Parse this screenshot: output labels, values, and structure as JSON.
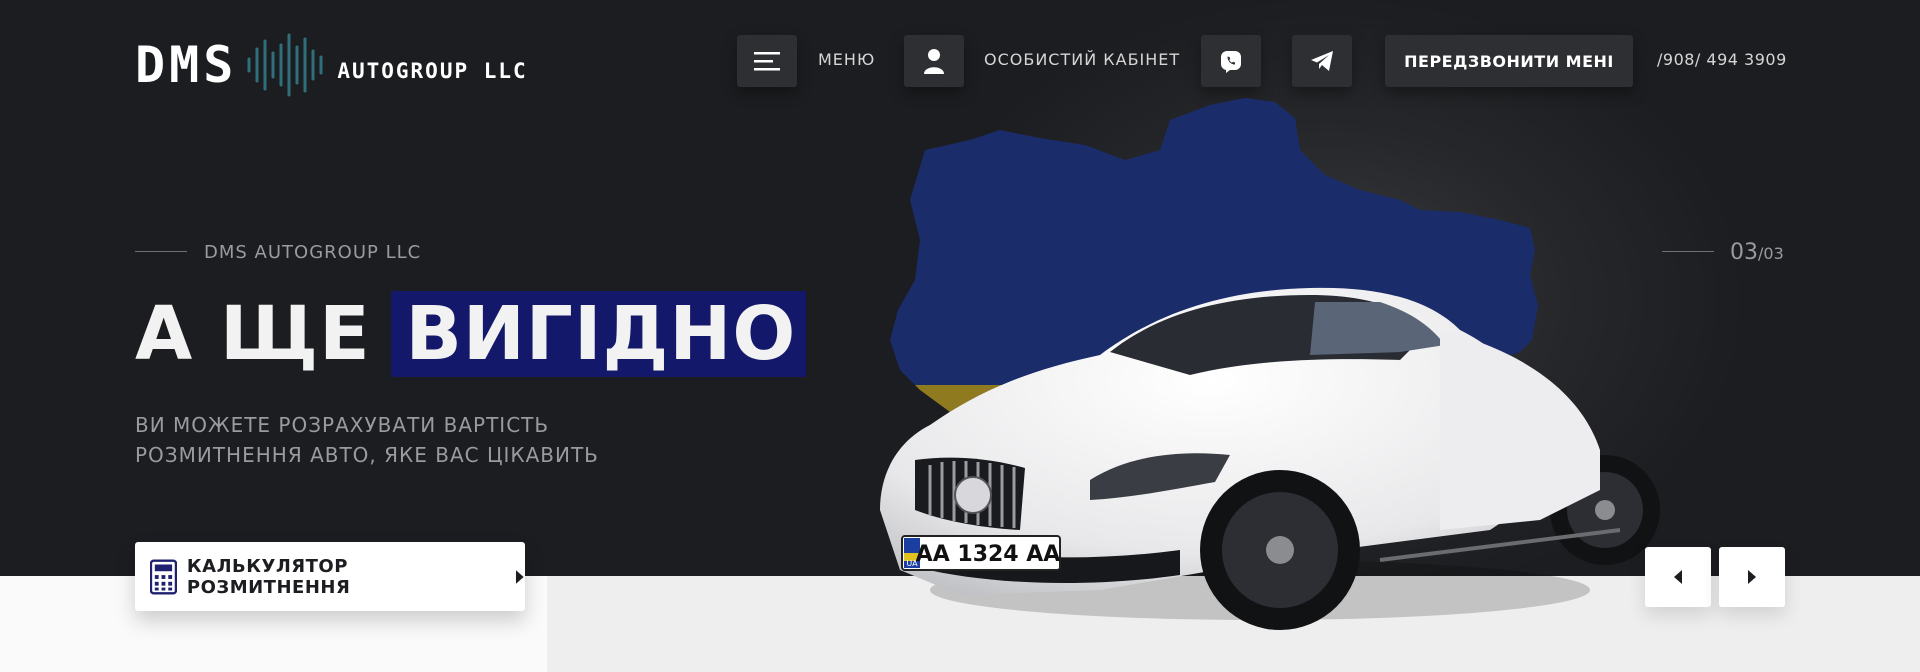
{
  "header": {
    "logo_main": "DMS",
    "logo_sub": "AUTOGROUP LLC",
    "menu_label": "МЕНЮ",
    "cabinet_label": "ОСОБИСТИЙ КАБІНЕТ",
    "callback_label": "ПЕРЕДЗВОНИТИ МЕНІ",
    "phone": "/908/ 494 3909"
  },
  "hero": {
    "eyebrow": "DMS AUTOGROUP LLC",
    "headline_plain": "А ЩЕ ",
    "headline_highlight": "ВИГІДНО",
    "subtext_line1": "ВИ МОЖЕТЕ РОЗРАХУВАТИ ВАРТІСТЬ",
    "subtext_line2": "РОЗМИТНЕННЯ АВТО, ЯКЕ ВАС ЦІКАВИТЬ",
    "cta_label": "КАЛЬКУЛЯТОР РОЗМИТНЕННЯ",
    "slide_current": "03",
    "slide_total": "/03",
    "plate_text": "AA 1324 AA",
    "plate_country": "UA"
  },
  "colors": {
    "background": "#1c1d20",
    "highlight": "#14186a",
    "flag_blue": "#1b2c6b",
    "flag_yellow": "#8f7a1f",
    "button_dark": "#2e2f33",
    "logo_wave": "#2f6f7a"
  },
  "icons": {
    "menu": "hamburger-icon",
    "cabinet": "user-icon",
    "viber": "viber-icon",
    "telegram": "telegram-icon",
    "calculator": "calculator-icon",
    "cta_arrow": "caret-right-icon",
    "prev": "caret-left-icon",
    "next": "caret-right-icon"
  }
}
